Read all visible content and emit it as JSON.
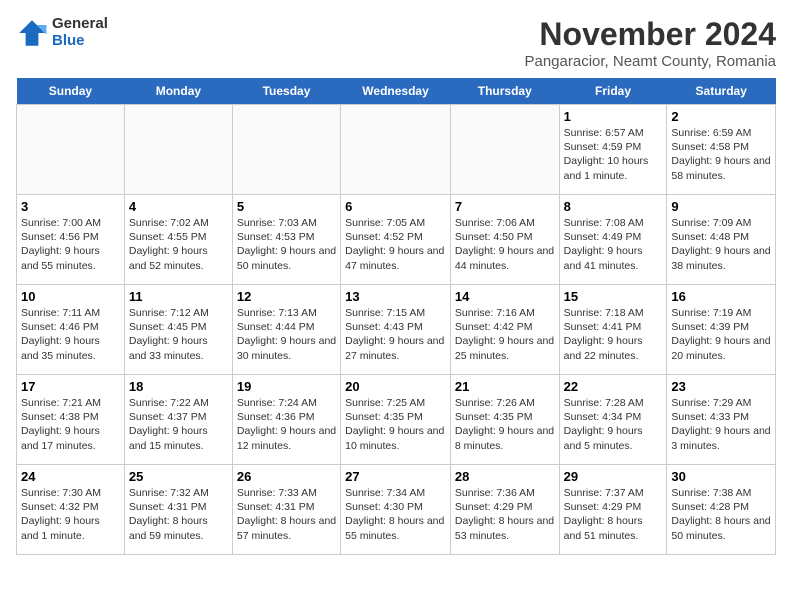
{
  "logo": {
    "general": "General",
    "blue": "Blue"
  },
  "title": "November 2024",
  "subtitle": "Pangaracior, Neamt County, Romania",
  "headers": [
    "Sunday",
    "Monday",
    "Tuesday",
    "Wednesday",
    "Thursday",
    "Friday",
    "Saturday"
  ],
  "weeks": [
    [
      {
        "day": "",
        "text": "",
        "empty": true
      },
      {
        "day": "",
        "text": "",
        "empty": true
      },
      {
        "day": "",
        "text": "",
        "empty": true
      },
      {
        "day": "",
        "text": "",
        "empty": true
      },
      {
        "day": "",
        "text": "",
        "empty": true
      },
      {
        "day": "1",
        "text": "Sunrise: 6:57 AM\nSunset: 4:59 PM\nDaylight: 10 hours and 1 minute."
      },
      {
        "day": "2",
        "text": "Sunrise: 6:59 AM\nSunset: 4:58 PM\nDaylight: 9 hours and 58 minutes."
      }
    ],
    [
      {
        "day": "3",
        "text": "Sunrise: 7:00 AM\nSunset: 4:56 PM\nDaylight: 9 hours and 55 minutes."
      },
      {
        "day": "4",
        "text": "Sunrise: 7:02 AM\nSunset: 4:55 PM\nDaylight: 9 hours and 52 minutes."
      },
      {
        "day": "5",
        "text": "Sunrise: 7:03 AM\nSunset: 4:53 PM\nDaylight: 9 hours and 50 minutes."
      },
      {
        "day": "6",
        "text": "Sunrise: 7:05 AM\nSunset: 4:52 PM\nDaylight: 9 hours and 47 minutes."
      },
      {
        "day": "7",
        "text": "Sunrise: 7:06 AM\nSunset: 4:50 PM\nDaylight: 9 hours and 44 minutes."
      },
      {
        "day": "8",
        "text": "Sunrise: 7:08 AM\nSunset: 4:49 PM\nDaylight: 9 hours and 41 minutes."
      },
      {
        "day": "9",
        "text": "Sunrise: 7:09 AM\nSunset: 4:48 PM\nDaylight: 9 hours and 38 minutes."
      }
    ],
    [
      {
        "day": "10",
        "text": "Sunrise: 7:11 AM\nSunset: 4:46 PM\nDaylight: 9 hours and 35 minutes."
      },
      {
        "day": "11",
        "text": "Sunrise: 7:12 AM\nSunset: 4:45 PM\nDaylight: 9 hours and 33 minutes."
      },
      {
        "day": "12",
        "text": "Sunrise: 7:13 AM\nSunset: 4:44 PM\nDaylight: 9 hours and 30 minutes."
      },
      {
        "day": "13",
        "text": "Sunrise: 7:15 AM\nSunset: 4:43 PM\nDaylight: 9 hours and 27 minutes."
      },
      {
        "day": "14",
        "text": "Sunrise: 7:16 AM\nSunset: 4:42 PM\nDaylight: 9 hours and 25 minutes."
      },
      {
        "day": "15",
        "text": "Sunrise: 7:18 AM\nSunset: 4:41 PM\nDaylight: 9 hours and 22 minutes."
      },
      {
        "day": "16",
        "text": "Sunrise: 7:19 AM\nSunset: 4:39 PM\nDaylight: 9 hours and 20 minutes."
      }
    ],
    [
      {
        "day": "17",
        "text": "Sunrise: 7:21 AM\nSunset: 4:38 PM\nDaylight: 9 hours and 17 minutes."
      },
      {
        "day": "18",
        "text": "Sunrise: 7:22 AM\nSunset: 4:37 PM\nDaylight: 9 hours and 15 minutes."
      },
      {
        "day": "19",
        "text": "Sunrise: 7:24 AM\nSunset: 4:36 PM\nDaylight: 9 hours and 12 minutes."
      },
      {
        "day": "20",
        "text": "Sunrise: 7:25 AM\nSunset: 4:35 PM\nDaylight: 9 hours and 10 minutes."
      },
      {
        "day": "21",
        "text": "Sunrise: 7:26 AM\nSunset: 4:35 PM\nDaylight: 9 hours and 8 minutes."
      },
      {
        "day": "22",
        "text": "Sunrise: 7:28 AM\nSunset: 4:34 PM\nDaylight: 9 hours and 5 minutes."
      },
      {
        "day": "23",
        "text": "Sunrise: 7:29 AM\nSunset: 4:33 PM\nDaylight: 9 hours and 3 minutes."
      }
    ],
    [
      {
        "day": "24",
        "text": "Sunrise: 7:30 AM\nSunset: 4:32 PM\nDaylight: 9 hours and 1 minute."
      },
      {
        "day": "25",
        "text": "Sunrise: 7:32 AM\nSunset: 4:31 PM\nDaylight: 8 hours and 59 minutes."
      },
      {
        "day": "26",
        "text": "Sunrise: 7:33 AM\nSunset: 4:31 PM\nDaylight: 8 hours and 57 minutes."
      },
      {
        "day": "27",
        "text": "Sunrise: 7:34 AM\nSunset: 4:30 PM\nDaylight: 8 hours and 55 minutes."
      },
      {
        "day": "28",
        "text": "Sunrise: 7:36 AM\nSunset: 4:29 PM\nDaylight: 8 hours and 53 minutes."
      },
      {
        "day": "29",
        "text": "Sunrise: 7:37 AM\nSunset: 4:29 PM\nDaylight: 8 hours and 51 minutes."
      },
      {
        "day": "30",
        "text": "Sunrise: 7:38 AM\nSunset: 4:28 PM\nDaylight: 8 hours and 50 minutes."
      }
    ]
  ]
}
